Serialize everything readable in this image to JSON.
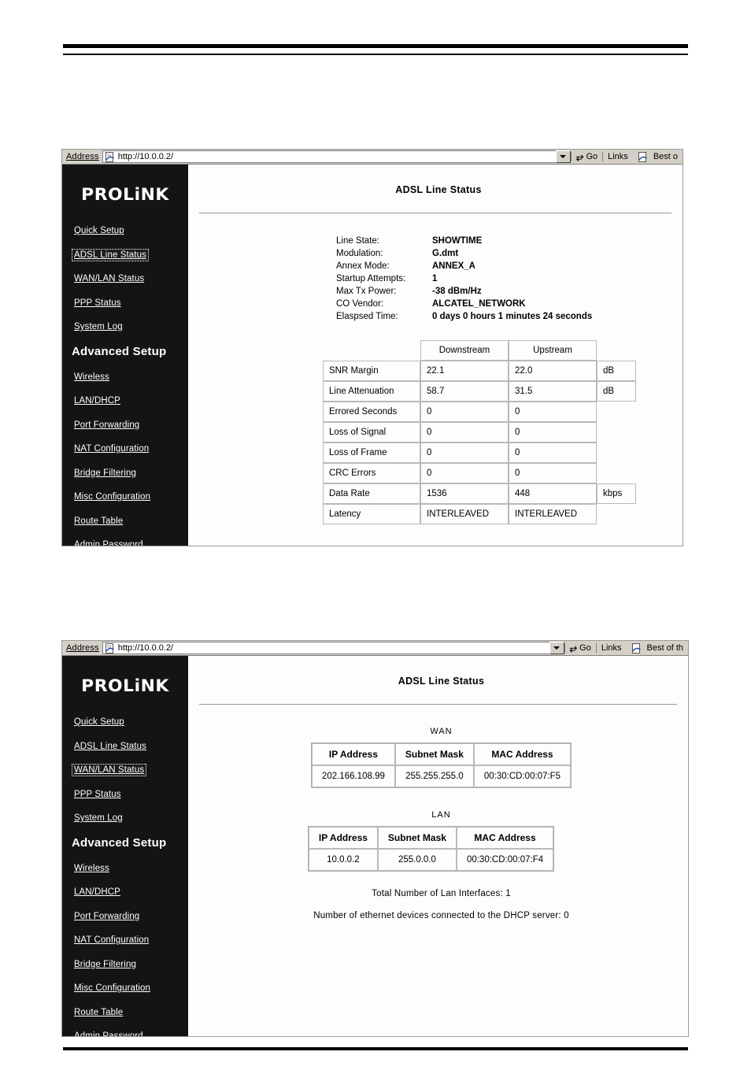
{
  "browser": {
    "address_label": "Address",
    "url": "http://10.0.0.2/",
    "go_label": "Go",
    "links_label": "Links",
    "best_label_1": "Best o",
    "best_label_2": "Best of th",
    "ie_icon": "ie-page-icon",
    "dropdown_icon": "chevron-down-icon",
    "go_icon": "go-arrow-icon"
  },
  "brand": {
    "logo_text": "PROLiNK"
  },
  "sidebar": {
    "items": [
      {
        "label": "Quick Setup",
        "name": "quick-setup"
      },
      {
        "label": "ADSL Line Status",
        "name": "adsl-line-status"
      },
      {
        "label": "WAN/LAN Status",
        "name": "wan-lan-status"
      },
      {
        "label": "PPP Status",
        "name": "ppp-status"
      },
      {
        "label": "System Log",
        "name": "system-log"
      }
    ],
    "advanced_heading": "Advanced Setup",
    "advanced_items": [
      {
        "label": "Wireless",
        "name": "wireless"
      },
      {
        "label": "LAN/DHCP",
        "name": "lan-dhcp"
      },
      {
        "label": "Port Forwarding",
        "name": "port-forwarding"
      },
      {
        "label": "NAT Configuration",
        "name": "nat-configuration"
      },
      {
        "label": "Bridge Filtering",
        "name": "bridge-filtering"
      },
      {
        "label": "Misc Configuration",
        "name": "misc-configuration"
      },
      {
        "label": "Route Table",
        "name": "route-table"
      },
      {
        "label": "Admin Password",
        "name": "admin-password"
      }
    ]
  },
  "shot1": {
    "page_title": "ADSL Line Status",
    "selected_menu": "ADSL Line Status",
    "summary": [
      {
        "key": "Line State:",
        "value": "SHOWTIME"
      },
      {
        "key": "Modulation:",
        "value": "G.dmt"
      },
      {
        "key": "Annex Mode:",
        "value": "ANNEX_A"
      },
      {
        "key": "Startup Attempts:",
        "value": "1"
      },
      {
        "key": "Max Tx Power:",
        "value": "-38 dBm/Hz"
      },
      {
        "key": "CO Vendor:",
        "value": "ALCATEL_NETWORK"
      },
      {
        "key": "Elaspsed Time:",
        "value": "0 days 0 hours 1 minutes 24 seconds"
      }
    ],
    "table": {
      "col_downstream": "Downstream",
      "col_upstream": "Upstream",
      "rows": [
        {
          "label": "SNR Margin",
          "downstream": "22.1",
          "upstream": "22.0",
          "unit": "dB"
        },
        {
          "label": "Line Attenuation",
          "downstream": "58.7",
          "upstream": "31.5",
          "unit": "dB"
        },
        {
          "label": "Errored Seconds",
          "downstream": "0",
          "upstream": "0",
          "unit": ""
        },
        {
          "label": "Loss of Signal",
          "downstream": "0",
          "upstream": "0",
          "unit": ""
        },
        {
          "label": "Loss of Frame",
          "downstream": "0",
          "upstream": "0",
          "unit": ""
        },
        {
          "label": "CRC Errors",
          "downstream": "0",
          "upstream": "0",
          "unit": ""
        },
        {
          "label": "Data Rate",
          "downstream": "1536",
          "upstream": "448",
          "unit": "kbps"
        },
        {
          "label": "Latency",
          "downstream": "INTERLEAVED",
          "upstream": "INTERLEAVED",
          "unit": ""
        }
      ]
    }
  },
  "shot2": {
    "page_title": "ADSL Line Status",
    "selected_menu": "WAN/LAN Status",
    "wan_label": "WAN",
    "lan_label": "LAN",
    "headers": [
      "IP Address",
      "Subnet Mask",
      "MAC Address"
    ],
    "wan_row": [
      "202.166.108.99",
      "255.255.255.0",
      "00:30:CD:00:07:F5"
    ],
    "lan_row": [
      "10.0.0.2",
      "255.0.0.0",
      "00:30:CD:00:07:F4"
    ],
    "note_lan_interfaces": "Total Number of Lan Interfaces:  1",
    "note_dhcp_devices": "Number of ethernet devices connected to the DHCP server: 0"
  }
}
